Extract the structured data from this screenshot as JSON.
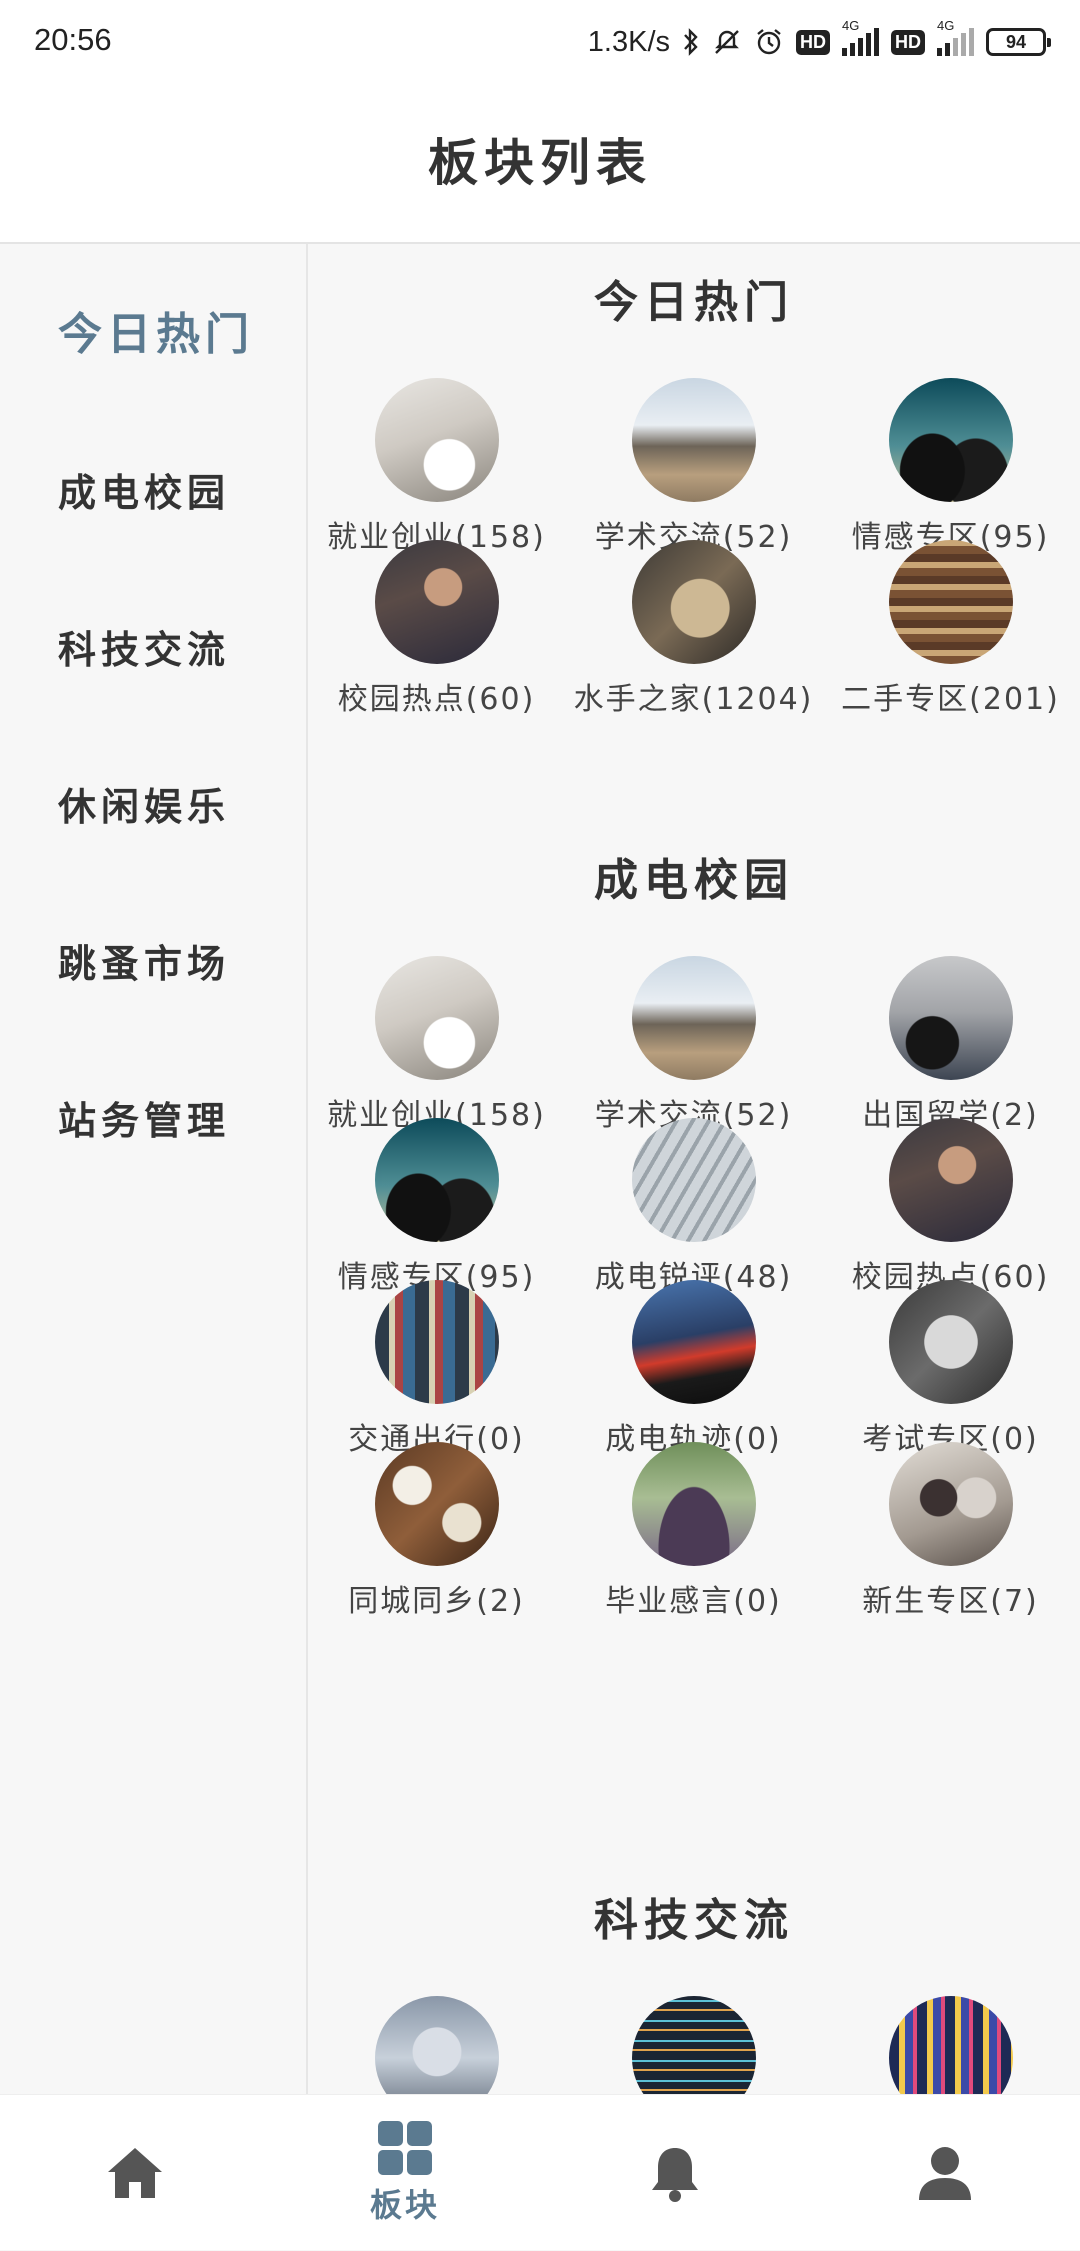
{
  "status_bar": {
    "time": "20:56",
    "net_speed": "1.3K/s",
    "hd1": "HD",
    "hd2": "HD",
    "sig1": "4G",
    "sig2": "4G",
    "battery": "94"
  },
  "header": {
    "title": "板块列表"
  },
  "sidebar": {
    "items": [
      {
        "label": "今日热门",
        "active": true
      },
      {
        "label": "成电校园"
      },
      {
        "label": "科技交流"
      },
      {
        "label": "休闲娱乐"
      },
      {
        "label": "跳蚤市场"
      },
      {
        "label": "站务管理"
      }
    ]
  },
  "sections": [
    {
      "title": "今日热门",
      "boards": [
        {
          "label": "就业创业(158)",
          "icon": "laptop-photo"
        },
        {
          "label": "学术交流(52)",
          "icon": "meeting-photo"
        },
        {
          "label": "情感专区(95)",
          "icon": "couple-photo"
        },
        {
          "label": "校园热点(60)",
          "icon": "student-photo"
        },
        {
          "label": "水手之家(1204)",
          "icon": "rope-photo"
        },
        {
          "label": "二手专区(201)",
          "icon": "books-photo"
        }
      ]
    },
    {
      "title": "成电校园",
      "boards": [
        {
          "label": "就业创业(158)",
          "icon": "laptop-photo"
        },
        {
          "label": "学术交流(52)",
          "icon": "meeting-photo"
        },
        {
          "label": "出国留学(2)",
          "icon": "gallery-photo"
        },
        {
          "label": "情感专区(95)",
          "icon": "couple-photo"
        },
        {
          "label": "成电锐评(48)",
          "icon": "newspaper-photo"
        },
        {
          "label": "校园热点(60)",
          "icon": "student-photo"
        },
        {
          "label": "交通出行(0)",
          "icon": "traffic-photo"
        },
        {
          "label": "成电轨迹(0)",
          "icon": "light-trail-photo"
        },
        {
          "label": "考试专区(0)",
          "icon": "test-photo"
        },
        {
          "label": "同城同乡(2)",
          "icon": "dining-photo"
        },
        {
          "label": "毕业感言(0)",
          "icon": "graduation-photo"
        },
        {
          "label": "新生专区(7)",
          "icon": "freshmen-photo"
        }
      ]
    },
    {
      "title": "科技交流",
      "boards": [
        {
          "label": "",
          "icon": "robot-photo"
        },
        {
          "label": "",
          "icon": "code-photo"
        },
        {
          "label": "",
          "icon": "server-photo"
        }
      ]
    }
  ],
  "tabbar": {
    "items": [
      {
        "label": "",
        "icon": "home-icon"
      },
      {
        "label": "板块",
        "icon": "grid-icon",
        "active": true
      },
      {
        "label": "",
        "icon": "bell-icon"
      },
      {
        "label": "",
        "icon": "user-icon"
      }
    ]
  },
  "colors": {
    "accent": "#5b7a90",
    "icon_inactive": "#555555",
    "text": "#333333",
    "background": "#f7f7f7"
  }
}
